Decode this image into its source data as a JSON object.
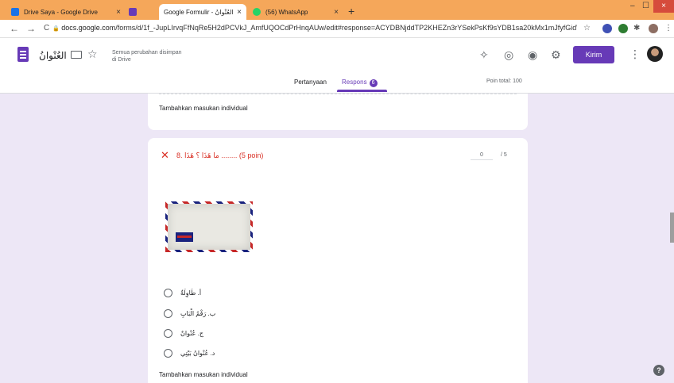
{
  "browser": {
    "tabs": [
      {
        "title": "Drive Saya - Google Drive",
        "close": "×",
        "icon_color": "#1a73e8"
      },
      {
        "title": "Google Formulir - العُنْوانُ",
        "close": "×",
        "icon_color": "#673ab7"
      },
      {
        "title": "(56) WhatsApp",
        "close": "×",
        "icon_color": "#25d366"
      }
    ],
    "new_tab": "+",
    "window_controls": {
      "minimize": "–",
      "maximize": "☐",
      "close": "×"
    },
    "url": {
      "lock": "🔒",
      "host": "docs.google.com",
      "path": "/forms/d/1f_-JupLIrvqFfNqRe5H2dPCVkJ_AmfUQOCdPrHnqAUw/edit#response=ACYDBNjddTP2KHEZn3rYSekPsKf9sYDB1sa20kMx1mJfyfGidWTf..."
    },
    "nav": {
      "back": "←",
      "forward": "→",
      "reload": "C"
    }
  },
  "form": {
    "title": "العُنْوانُ",
    "saved_line1": "Semua perubahan disimpan",
    "saved_line2": "di Drive",
    "send_label": "Kirim",
    "menu": "⋮",
    "tabs": {
      "questions": "Pertanyaan",
      "responses": "Respons",
      "responses_count": "6"
    },
    "points_total": "Poin total: 100"
  },
  "card_prev": {
    "add_feedback": "Tambahkan masukan individual"
  },
  "question": {
    "status_icon": "✕",
    "text": "8. ما هَذَا ؟ هَذَا ........  (5 poin)",
    "score": "0",
    "out_of": "/ 5",
    "options": [
      "أ. طَاوِلَةٌ",
      "ب. رَقْمُ الْبَابِ",
      "ج. عُنْوانٌ",
      "د. عُنْوانُ بَيْتِي"
    ],
    "add_feedback": "Tambahkan masukan individual"
  },
  "help": "?"
}
